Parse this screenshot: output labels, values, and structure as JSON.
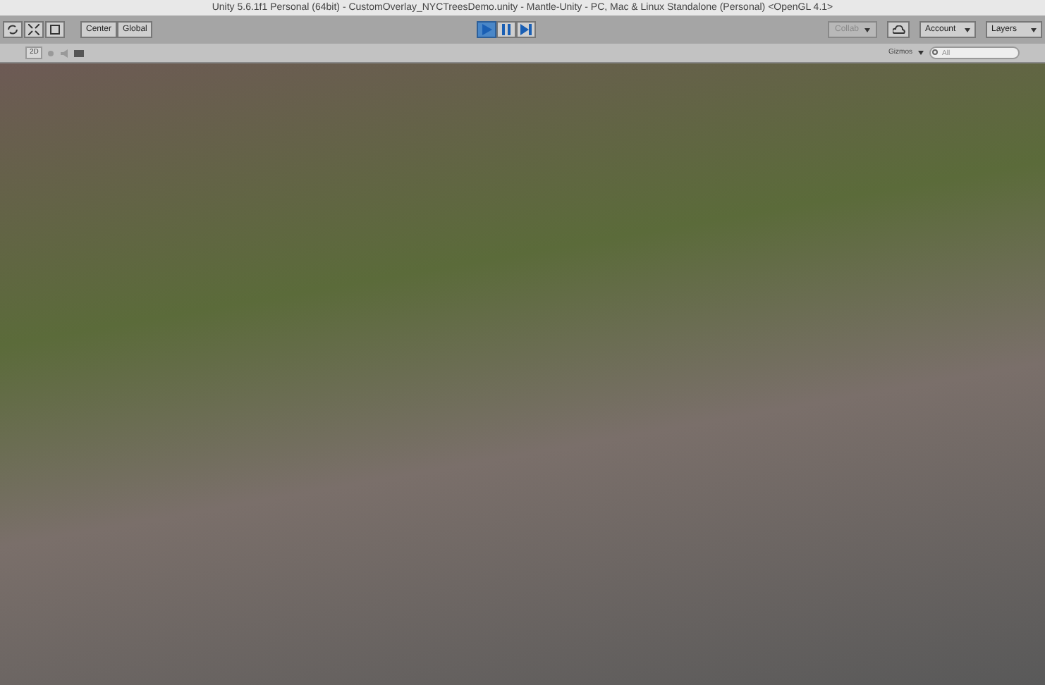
{
  "window": {
    "title": "Unity 5.6.1f1 Personal (64bit) - CustomOverlay_NYCTreesDemo.unity - Mantle-Unity - PC, Mac & Linux Standalone (Personal) <OpenGL 4.1>"
  },
  "toolbar": {
    "pivot_buttons": [
      "Center",
      "Global"
    ],
    "play_controls": [
      {
        "kind": "play",
        "selected": true
      },
      {
        "kind": "pause",
        "selected": false
      },
      {
        "kind": "step",
        "selected": false
      }
    ],
    "collab": {
      "label": "Collab",
      "disabled": true
    },
    "account": "Account",
    "layers": "Layers"
  },
  "scene_toolbar": {
    "mode_2d": "2D",
    "gizmos": "Gizmos",
    "search": {
      "placeholder": "All"
    }
  }
}
